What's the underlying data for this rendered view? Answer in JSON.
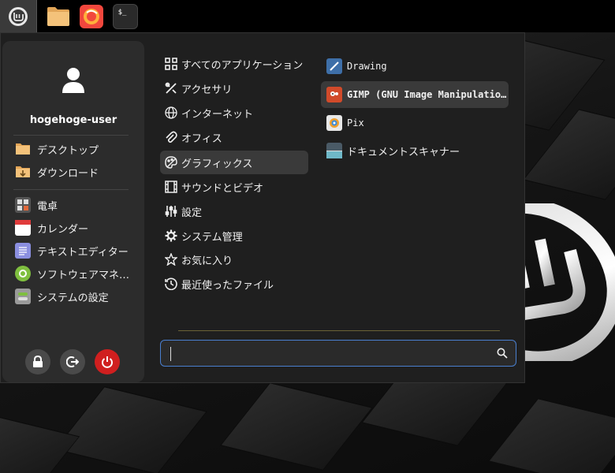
{
  "taskbar": {
    "menu_icon": "linux-mint-icon",
    "apps": [
      "files-icon",
      "firefox-icon",
      "terminal-icon"
    ],
    "terminal_glyph": "$_"
  },
  "sidebar": {
    "username": "hogehoge-user",
    "places": [
      {
        "label": "デスクトップ",
        "icon": "desktop-folder-icon"
      },
      {
        "label": "ダウンロード",
        "icon": "downloads-folder-icon"
      }
    ],
    "favorites": [
      {
        "label": "電卓",
        "icon": "calculator-icon"
      },
      {
        "label": "カレンダー",
        "icon": "calendar-icon"
      },
      {
        "label": "テキストエディター",
        "icon": "text-editor-icon"
      },
      {
        "label": "ソフトウェアマネ…",
        "icon": "software-manager-icon"
      },
      {
        "label": "システムの設定",
        "icon": "system-settings-icon"
      }
    ],
    "actions": [
      "lock-icon",
      "logout-icon",
      "power-icon"
    ]
  },
  "categories": [
    {
      "label": "すべてのアプリケーション",
      "icon": "grid-icon"
    },
    {
      "label": "アクセサリ",
      "icon": "tools-icon"
    },
    {
      "label": "インターネット",
      "icon": "globe-icon"
    },
    {
      "label": "オフィス",
      "icon": "paperclip-icon"
    },
    {
      "label": "グラフィックス",
      "icon": "palette-icon"
    },
    {
      "label": "サウンドとビデオ",
      "icon": "film-icon"
    },
    {
      "label": "設定",
      "icon": "sliders-icon"
    },
    {
      "label": "システム管理",
      "icon": "gear-icon"
    },
    {
      "label": "お気に入り",
      "icon": "star-icon"
    },
    {
      "label": "最近使ったファイル",
      "icon": "history-icon"
    }
  ],
  "selected_category": "グラフィックス",
  "apps": [
    {
      "label": "Drawing",
      "icon": "drawing-icon"
    },
    {
      "label": "GIMP (GNU Image Manipulation Pr…",
      "icon": "gimp-icon"
    },
    {
      "label": "Pix",
      "icon": "pix-icon"
    },
    {
      "label": "ドキュメントスキャナー",
      "icon": "scanner-icon"
    }
  ],
  "selected_app": "GIMP (GNU Image Manipulation Pr…",
  "search": {
    "value": "",
    "placeholder": ""
  },
  "colors": {
    "accent": "#4a7fcf",
    "power": "#d01f1f",
    "menu_bg": "#1f1f1f",
    "sidebar_bg": "#2c2c2c"
  }
}
